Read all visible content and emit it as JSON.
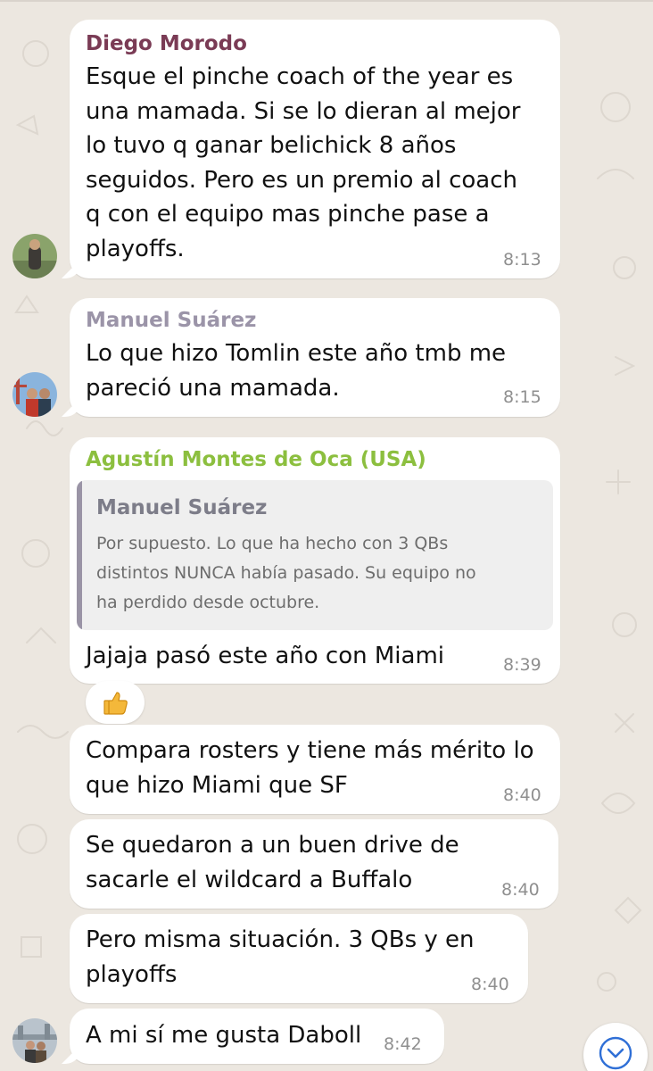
{
  "colors": {
    "chat_background": "#ece7e0",
    "bubble": "#ffffff",
    "sender_diego": "#7a3b55",
    "sender_manuel": "#9b94a8",
    "sender_agustin": "#8cbf3f",
    "timestamp": "#8f8f8f",
    "scroll_icon": "#2f6fd6"
  },
  "messages": [
    {
      "sender": "Diego Morodo",
      "lines": [
        "Esque el pinche coach of the year es",
        "una mamada. Si se lo dieran al mejor",
        "lo tuvo q ganar belichick 8 años",
        "seguidos. Pero es un premio al coach",
        "q con el equipo mas pinche pase a",
        "playoffs."
      ],
      "time": "8:13"
    },
    {
      "sender": "Manuel Suárez",
      "lines": [
        "Lo que hizo Tomlin este año tmb me",
        "pareció una mamada."
      ],
      "time": "8:15"
    },
    {
      "sender": "Agustín Montes de Oca (USA)",
      "quote": {
        "sender": "Manuel Suárez",
        "lines": [
          "Por supuesto. Lo que ha hecho con 3 QBs",
          "distintos NUNCA había pasado. Su equipo no",
          "ha perdido desde octubre."
        ]
      },
      "lines": [
        "Jajaja pasó este año con Miami"
      ],
      "time": "8:39",
      "reaction": "thumbs-up-icon"
    },
    {
      "lines": [
        "Compara rosters y tiene más mérito lo",
        "que hizo Miami que SF"
      ],
      "time": "8:40"
    },
    {
      "lines": [
        "Se quedaron a un buen drive de",
        "sacarle el wildcard a Buffalo"
      ],
      "time": "8:40"
    },
    {
      "lines": [
        "Pero misma situación. 3 QBs y en",
        "playoffs"
      ],
      "time": "8:40"
    },
    {
      "lines": [
        "A mi sí me gusta Daboll"
      ],
      "time": "8:42"
    }
  ],
  "scroll_button": {
    "icon": "chevron-down-icon"
  }
}
